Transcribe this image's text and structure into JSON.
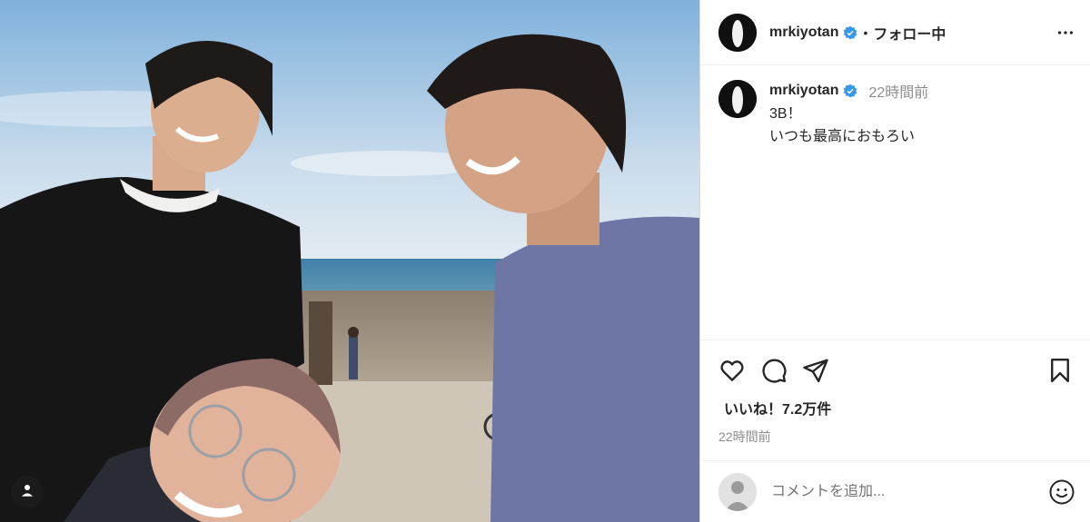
{
  "account": {
    "username": "mrkiyotan",
    "separator": "•",
    "follow_status": "フォロー中"
  },
  "caption": {
    "username": "mrkiyotan",
    "time": "22時間前",
    "line1": "3B！",
    "line2": "いつも最高におもろい"
  },
  "stats": {
    "likes": "いいね！7.2万件",
    "posted": "22時間前"
  },
  "comment": {
    "placeholder": "コメントを追加..."
  },
  "icons": {
    "verified": "verified-badge-icon",
    "more": "more-options-icon",
    "like": "heart-icon",
    "comment": "comment-bubble-icon",
    "share": "paper-plane-icon",
    "save": "bookmark-icon",
    "tagged": "person-tag-icon",
    "emoji": "smiley-icon"
  },
  "colors": {
    "verified_blue": "#3897f0",
    "muted_text": "#8e8e8e",
    "divider": "#efefef"
  }
}
